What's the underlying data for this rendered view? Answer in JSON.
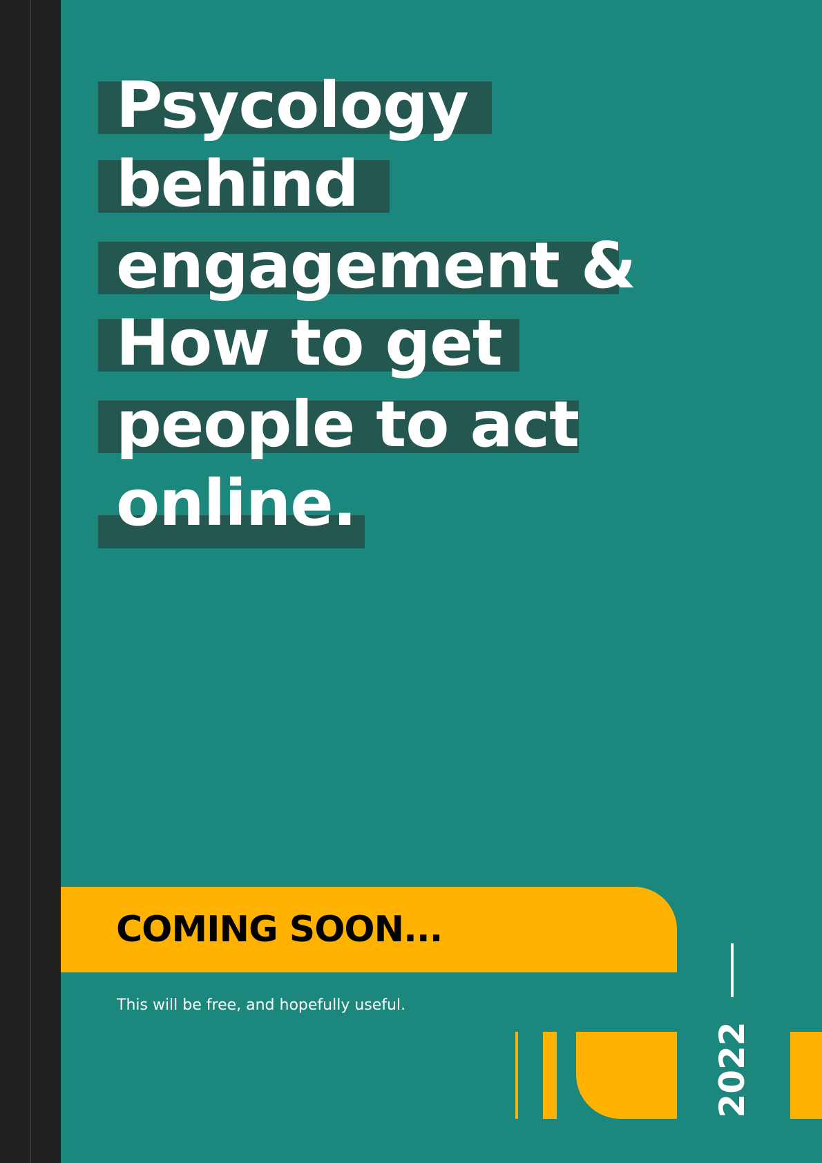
{
  "cover": {
    "title_lines": [
      "Psycology",
      "behind",
      "engagement &",
      "How to get",
      "people to act",
      "online."
    ],
    "banner_text": "COMING SOON...",
    "subtitle": "This will be free, and hopefully useful.",
    "year": "2022"
  },
  "colors": {
    "background": "#1b877d",
    "spine": "#202020",
    "title_highlight": "#24574f",
    "accent": "#ffb300",
    "title_text": "#ffffff",
    "banner_text": "#000000"
  }
}
